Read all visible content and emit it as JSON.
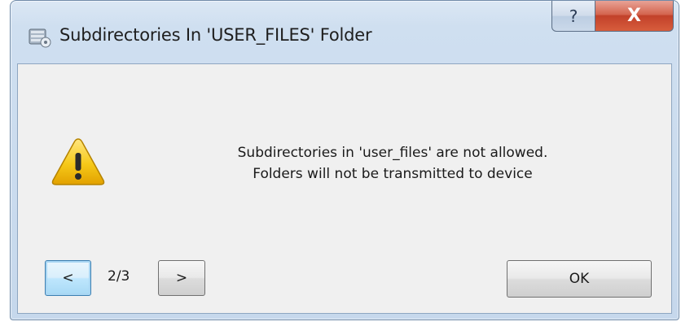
{
  "window": {
    "title": "Subdirectories In 'USER_FILES' Folder",
    "title_icon": "drive-disk-icon",
    "caption_buttons": {
      "help_label": "?",
      "close_label": "X"
    }
  },
  "dialog": {
    "icon": "warning-icon",
    "message_lines": [
      "Subdirectories in 'user_files' are not allowed.",
      "Folders will not be transmitted to device"
    ],
    "nav": {
      "prev_label": "<",
      "next_label": ">",
      "page_indicator": "2/3"
    },
    "ok_label": "OK"
  },
  "colors": {
    "title_bar": "#cfdff0",
    "close_button": "#c2412a",
    "client_background": "#f0f0f0",
    "warning_yellow": "#f3c400",
    "focus_border": "#3c7fb1"
  }
}
